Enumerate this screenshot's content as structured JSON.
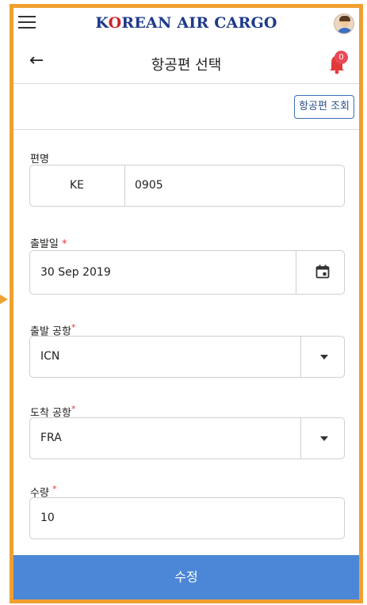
{
  "brand": {
    "prefix": "K",
    "mark": "O",
    "rest": "REAN AIR CARGO"
  },
  "header": {
    "title": "항공편 선택",
    "notification_count": "0"
  },
  "toolbar": {
    "lookup_label": "항공편 조회"
  },
  "form": {
    "flight_no": {
      "label": "편명",
      "carrier": "KE",
      "number": "0905"
    },
    "departure_date": {
      "label": "출발일",
      "required_mark": "*",
      "value": "30 Sep 2019"
    },
    "origin": {
      "label": "출발 공항",
      "required_mark": "*",
      "value": "ICN"
    },
    "destination": {
      "label": "도착 공항",
      "required_mark": "*",
      "value": "FRA"
    },
    "quantity": {
      "label": "수량",
      "required_mark": "*",
      "value": "10"
    }
  },
  "actions": {
    "submit_label": "수정"
  },
  "colors": {
    "accent_frame": "#f0a030",
    "primary": "#4c86d6",
    "brand_blue": "#1d3a8a",
    "required": "#e23a3a"
  }
}
